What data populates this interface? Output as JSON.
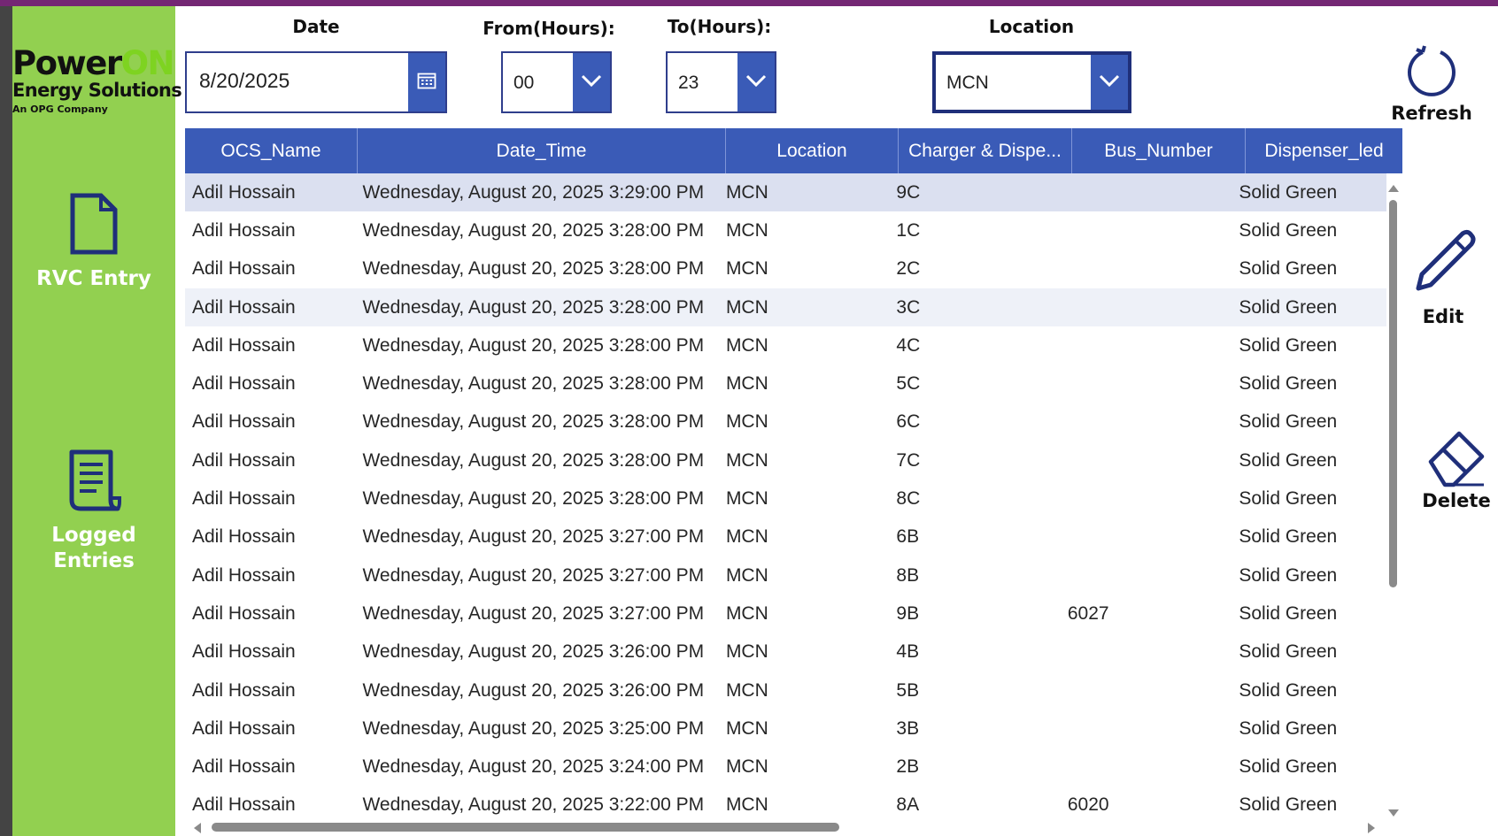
{
  "sidebar": {
    "logo": {
      "power": "Power",
      "on": "ON",
      "subtitle": "Energy Solutions",
      "tagline": "An OPG Company"
    },
    "nav": [
      {
        "label": "RVC Entry",
        "icon": "document-icon"
      },
      {
        "label": "Logged Entries",
        "icon": "receipt-list-icon"
      }
    ]
  },
  "filters": {
    "date": {
      "label": "Date",
      "value": "8/20/2025",
      "icon": "calendar-icon"
    },
    "from_hours": {
      "label": "From(Hours):",
      "value": "00"
    },
    "to_hours": {
      "label": "To(Hours):",
      "value": "23"
    },
    "location": {
      "label": "Location",
      "value": "MCN"
    }
  },
  "actions": {
    "refresh": {
      "label": "Refresh",
      "icon": "refresh-icon"
    },
    "edit": {
      "label": "Edit",
      "icon": "pencil-icon"
    },
    "delete": {
      "label": "Delete",
      "icon": "eraser-icon"
    }
  },
  "table": {
    "columns": [
      "OCS_Name",
      "Date_Time",
      "Location",
      "Charger & Dispe...",
      "Bus_Number",
      "Dispenser_led"
    ],
    "rows": [
      [
        "Adil Hossain",
        "Wednesday, August 20, 2025 3:29:00 PM",
        "MCN",
        "9C",
        "",
        "Solid Green"
      ],
      [
        "Adil Hossain",
        "Wednesday, August 20, 2025 3:28:00 PM",
        "MCN",
        "1C",
        "",
        "Solid Green"
      ],
      [
        "Adil Hossain",
        "Wednesday, August 20, 2025 3:28:00 PM",
        "MCN",
        "2C",
        "",
        "Solid Green"
      ],
      [
        "Adil Hossain",
        "Wednesday, August 20, 2025 3:28:00 PM",
        "MCN",
        "3C",
        "",
        "Solid Green"
      ],
      [
        "Adil Hossain",
        "Wednesday, August 20, 2025 3:28:00 PM",
        "MCN",
        "4C",
        "",
        "Solid Green"
      ],
      [
        "Adil Hossain",
        "Wednesday, August 20, 2025 3:28:00 PM",
        "MCN",
        "5C",
        "",
        "Solid Green"
      ],
      [
        "Adil Hossain",
        "Wednesday, August 20, 2025 3:28:00 PM",
        "MCN",
        "6C",
        "",
        "Solid Green"
      ],
      [
        "Adil Hossain",
        "Wednesday, August 20, 2025 3:28:00 PM",
        "MCN",
        "7C",
        "",
        "Solid Green"
      ],
      [
        "Adil Hossain",
        "Wednesday, August 20, 2025 3:28:00 PM",
        "MCN",
        "8C",
        "",
        "Solid Green"
      ],
      [
        "Adil Hossain",
        "Wednesday, August 20, 2025 3:27:00 PM",
        "MCN",
        "6B",
        "",
        "Solid Green"
      ],
      [
        "Adil Hossain",
        "Wednesday, August 20, 2025 3:27:00 PM",
        "MCN",
        "8B",
        "",
        "Solid Green"
      ],
      [
        "Adil Hossain",
        "Wednesday, August 20, 2025 3:27:00 PM",
        "MCN",
        "9B",
        "6027",
        "Solid Green"
      ],
      [
        "Adil Hossain",
        "Wednesday, August 20, 2025 3:26:00 PM",
        "MCN",
        "4B",
        "",
        "Solid Green"
      ],
      [
        "Adil Hossain",
        "Wednesday, August 20, 2025 3:26:00 PM",
        "MCN",
        "5B",
        "",
        "Solid Green"
      ],
      [
        "Adil Hossain",
        "Wednesday, August 20, 2025 3:25:00 PM",
        "MCN",
        "3B",
        "",
        "Solid Green"
      ],
      [
        "Adil Hossain",
        "Wednesday, August 20, 2025 3:24:00 PM",
        "MCN",
        "2B",
        "",
        "Solid Green"
      ],
      [
        "Adil Hossain",
        "Wednesday, August 20, 2025 3:22:00 PM",
        "MCN",
        "8A",
        "6020",
        "Solid Green"
      ]
    ]
  },
  "colors": {
    "sidebar_bg": "#92d050",
    "header_bg": "#3a5bb7",
    "icon_navy": "#1f2f7a",
    "selected_row": "#dbe0f0",
    "top_strip": "#742774"
  }
}
